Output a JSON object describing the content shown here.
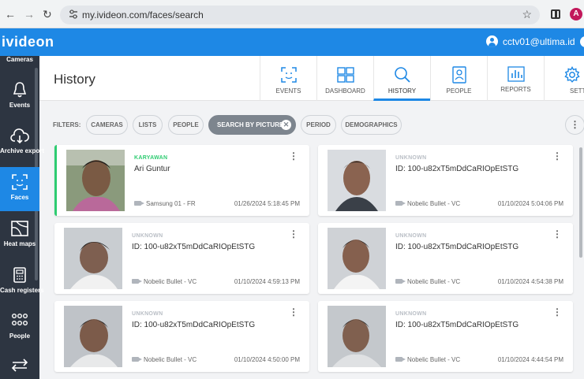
{
  "browser": {
    "url": "my.ivideon.com/faces/search",
    "profile_initial": "A"
  },
  "app": {
    "logo": "ivideon",
    "user": "cctv01@ultima.id",
    "brand_color": "#1e88e5"
  },
  "sidebar": {
    "top_label": "Cameras",
    "items": [
      {
        "label": "Events",
        "icon": "bell-icon"
      },
      {
        "label": "Archive export",
        "icon": "cloud-download-icon"
      },
      {
        "label": "Faces",
        "icon": "face-scan-icon",
        "active": true
      },
      {
        "label": "Heat maps",
        "icon": "heatmap-icon"
      },
      {
        "label": "Cash registers",
        "icon": "cash-register-icon"
      },
      {
        "label": "People",
        "icon": "people-icon"
      },
      {
        "label": "",
        "icon": "transfer-icon"
      }
    ]
  },
  "header": {
    "title": "History",
    "tabs": [
      {
        "label": "EVENTS",
        "icon": "face-scan-icon"
      },
      {
        "label": "DASHBOARD",
        "icon": "dashboard-icon"
      },
      {
        "label": "HISTORY",
        "icon": "search-icon",
        "active": true
      },
      {
        "label": "PEOPLE",
        "icon": "person-card-icon"
      },
      {
        "label": "REPORTS",
        "icon": "bar-chart-icon"
      },
      {
        "label": "SETTINGS",
        "icon": "gear-icon"
      }
    ]
  },
  "filters": {
    "label": "FILTERS:",
    "chips": [
      "CAMERAS",
      "LISTS",
      "PEOPLE",
      "SEARCH BY PICTURE",
      "PERIOD",
      "DEMOGRAPHICS"
    ],
    "active_chip": "SEARCH BY PICTURE"
  },
  "results": [
    {
      "tag": "KARYAWAN",
      "name": "Ari Guntur",
      "camera": "Samsung 01 - FR",
      "time": "01/26/2024 5:18:45 PM",
      "matched": true
    },
    {
      "tag": "UNKNOWN",
      "name": "ID: 100-u82xT5mDdCaRIOpEtSTG",
      "camera": "Nobelic Bullet - VC",
      "time": "01/10/2024 5:04:06 PM"
    },
    {
      "tag": "UNKNOWN",
      "name": "ID: 100-u82xT5mDdCaRIOpEtSTG",
      "camera": "Nobelic Bullet - VC",
      "time": "01/10/2024 4:59:13 PM"
    },
    {
      "tag": "UNKNOWN",
      "name": "ID: 100-u82xT5mDdCaRIOpEtSTG",
      "camera": "Nobelic Bullet - VC",
      "time": "01/10/2024 4:54:38 PM"
    },
    {
      "tag": "UNKNOWN",
      "name": "ID: 100-u82xT5mDdCaRIOpEtSTG",
      "camera": "Nobelic Bullet - VC",
      "time": "01/10/2024 4:50:00 PM"
    },
    {
      "tag": "UNKNOWN",
      "name": "ID: 100-u82xT5mDdCaRIOpEtSTG",
      "camera": "Nobelic Bullet - VC",
      "time": "01/10/2024 4:44:54 PM"
    }
  ]
}
